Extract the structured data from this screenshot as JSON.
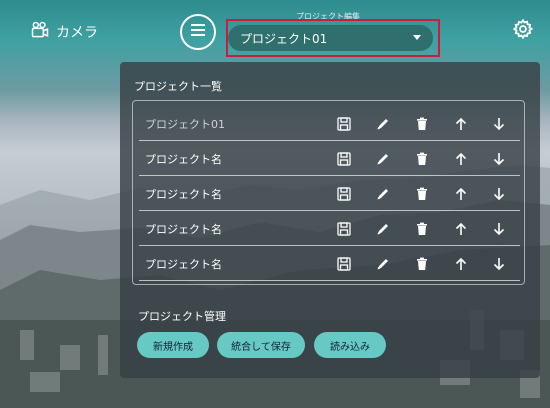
{
  "header": {
    "camera_label": "カメラ",
    "project_select_label": "プロジェクト編集",
    "project_selected": "プロジェクト01"
  },
  "panel": {
    "title": "プロジェクト一覧",
    "projects": [
      {
        "name": "プロジェクト01"
      },
      {
        "name": "プロジェクト名"
      },
      {
        "name": "プロジェクト名"
      },
      {
        "name": "プロジェクト名"
      },
      {
        "name": "プロジェクト名"
      }
    ],
    "management_title": "プロジェクト管理",
    "buttons": {
      "new": "新規作成",
      "merge_save": "統合して保存",
      "load": "読み込み"
    }
  },
  "colors": {
    "accent": "#66c9c4",
    "highlight": "#d0193f",
    "select_bg": "#2f6f6e"
  }
}
